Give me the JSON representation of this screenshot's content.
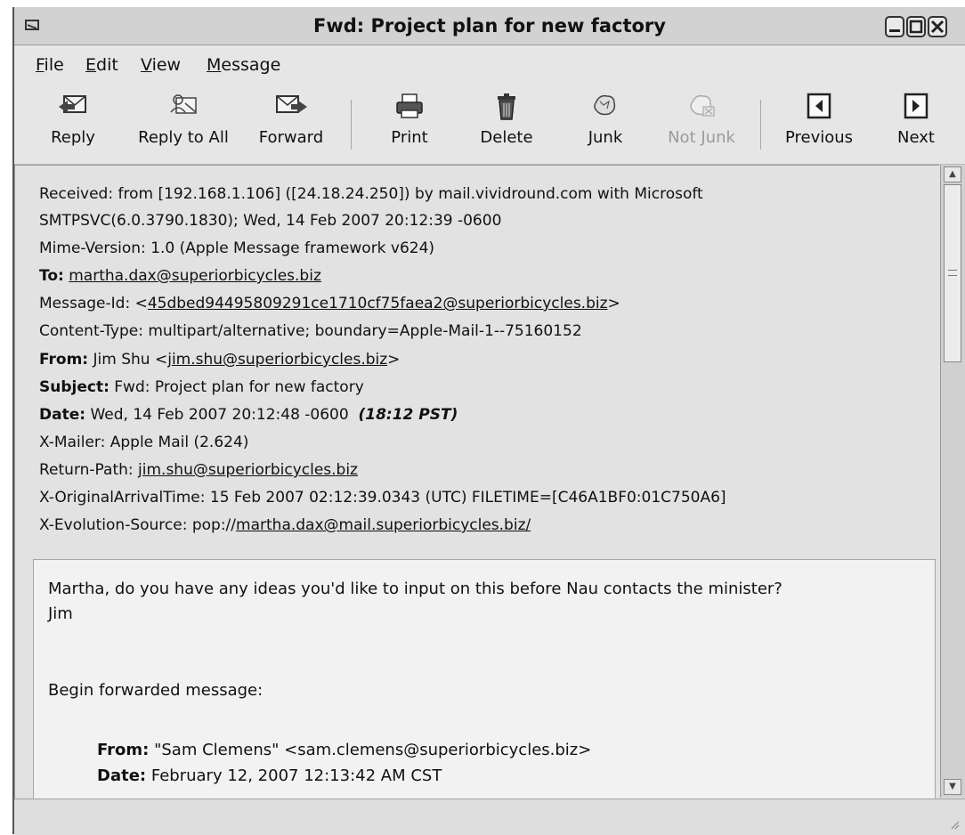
{
  "window": {
    "title": "Fwd: Project plan for new factory"
  },
  "menu": {
    "items": [
      {
        "label": "File",
        "ul": "F",
        "rest": "ile"
      },
      {
        "label": "Edit",
        "ul": "E",
        "rest": "dit"
      },
      {
        "label": "View",
        "ul": "V",
        "rest": "iew"
      },
      {
        "label": "Message",
        "ul": "M",
        "rest": "essage"
      }
    ]
  },
  "toolbar": {
    "reply": "Reply",
    "reply_all": "Reply to All",
    "forward": "Forward",
    "print": "Print",
    "delete": "Delete",
    "junk": "Junk",
    "not_junk": "Not Junk",
    "previous": "Previous",
    "next": "Next"
  },
  "headers": {
    "received_1": "Received: from [192.168.1.106] ([24.18.24.250]) by mail.vividround.com with Microsoft",
    "received_2": "SMTPSVC(6.0.3790.1830); Wed, 14 Feb 2007 20:12:39 -0600",
    "mime": "Mime-Version: 1.0 (Apple Message framework v624)",
    "to_label": "To:",
    "to_value": "martha.dax@superiorbicycles.biz",
    "msgid_prefix": "Message-Id: <",
    "msgid_value": "45dbed94495809291ce1710cf75faea2@superiorbicycles.biz",
    "msgid_suffix": ">",
    "content_type": "Content-Type: multipart/alternative; boundary=Apple-Mail-1--75160152",
    "from_label": "From:",
    "from_name": "Jim Shu <",
    "from_email": "jim.shu@superiorbicycles.biz",
    "from_suffix": ">",
    "subject_label": "Subject:",
    "subject_value": "Fwd: Project plan for new factory",
    "date_label": "Date:",
    "date_value": "Wed, 14 Feb 2007 20:12:48 -0600",
    "date_local": "(18:12 PST)",
    "xmailer": "X-Mailer: Apple Mail (2.624)",
    "returnpath_prefix": "Return-Path: ",
    "returnpath_value": "jim.shu@superiorbicycles.biz",
    "arrival": "X-OriginalArrivalTime: 15 Feb 2007 02:12:39.0343 (UTC) FILETIME=[C46A1BF0:01C750A6]",
    "evo_prefix": "X-Evolution-Source: pop://",
    "evo_value": "martha.dax@mail.superiorbicycles.biz/"
  },
  "body": {
    "line1": "Martha, do you have any ideas you'd like to input on this before Nau contacts the minister?",
    "line2": "Jim",
    "fwd_intro": "Begin forwarded message:",
    "fwd_from_label": "From:",
    "fwd_from_value": "\"Sam Clemens\" <sam.clemens@superiorbicycles.biz>",
    "fwd_date_label": "Date:",
    "fwd_date_value": "February 12, 2007 12:13:42 AM CST"
  }
}
